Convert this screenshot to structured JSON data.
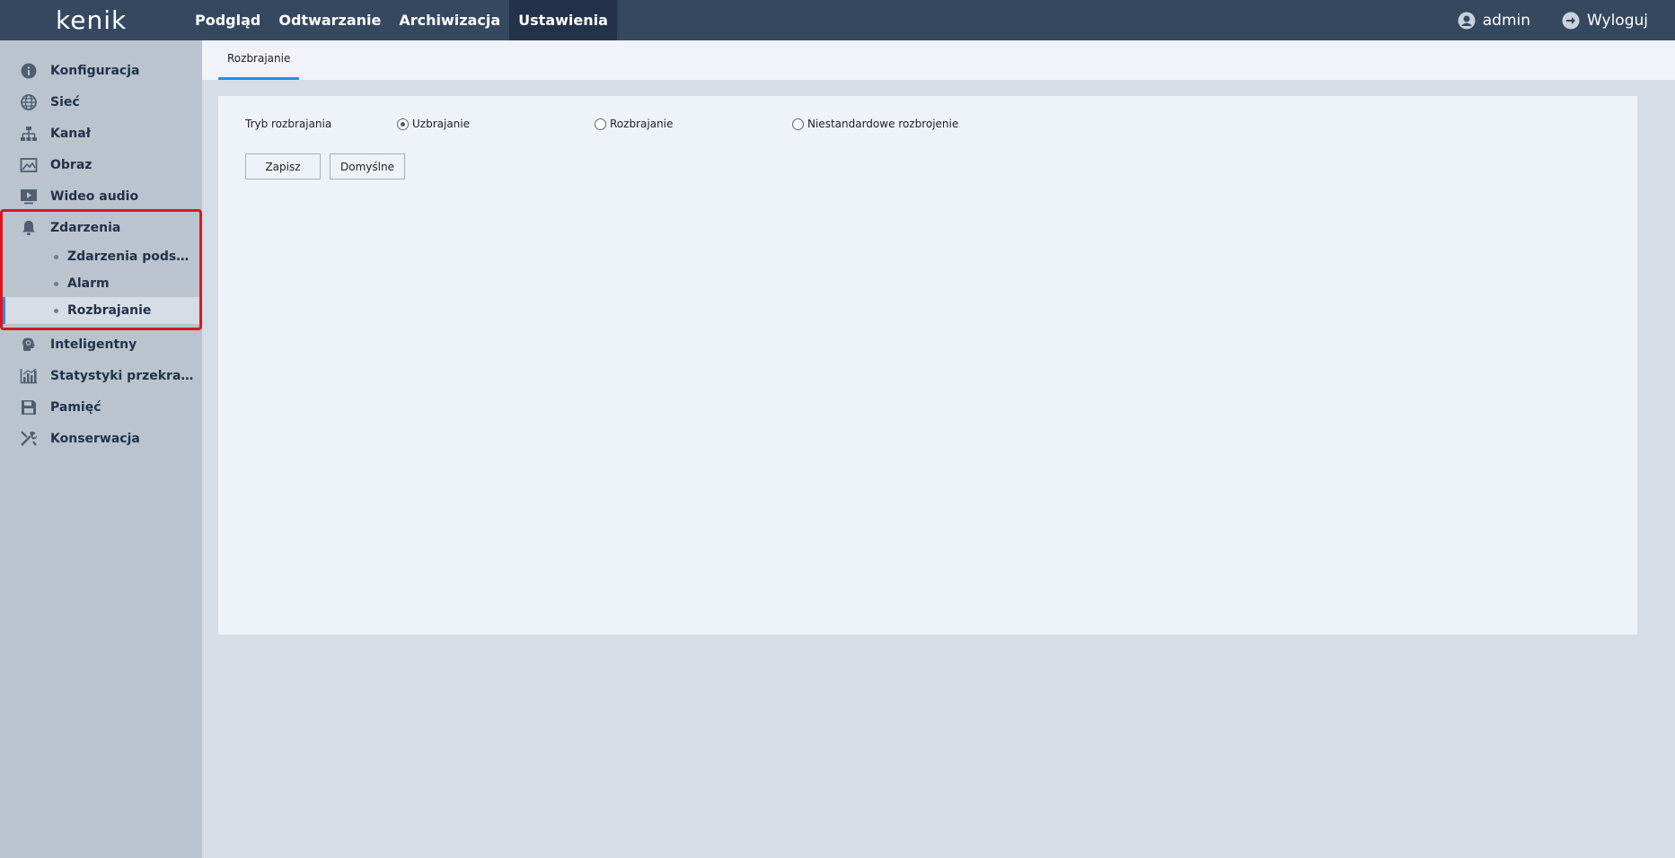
{
  "app": {
    "logo": "kenik"
  },
  "topnav": {
    "items": [
      {
        "label": "Podgląd"
      },
      {
        "label": "Odtwarzanie"
      },
      {
        "label": "Archiwizacja"
      },
      {
        "label": "Ustawienia"
      }
    ],
    "active_index": 3,
    "user": "admin",
    "logout": "Wyloguj"
  },
  "sidebar": {
    "items": [
      {
        "label": "Konfiguracja",
        "icon": "info-icon"
      },
      {
        "label": "Sieć",
        "icon": "globe-icon"
      },
      {
        "label": "Kanał",
        "icon": "network-icon"
      },
      {
        "label": "Obraz",
        "icon": "image-icon"
      },
      {
        "label": "Wideo audio",
        "icon": "video-icon"
      },
      {
        "label": "Zdarzenia",
        "icon": "bell-icon"
      },
      {
        "label": "Inteligentny",
        "icon": "brain-icon"
      },
      {
        "label": "Statystyki przekraczania",
        "icon": "chart-icon"
      },
      {
        "label": "Pamięć",
        "icon": "save-icon"
      },
      {
        "label": "Konserwacja",
        "icon": "tools-icon"
      }
    ],
    "subitems": [
      {
        "label": "Zdarzenia podstawowe"
      },
      {
        "label": "Alarm"
      },
      {
        "label": "Rozbrajanie"
      }
    ],
    "active_sub": "Rozbrajanie"
  },
  "main": {
    "tab": "Rozbrajanie",
    "mode_label": "Tryb rozbrajania",
    "options": [
      {
        "label": "Uzbrajanie",
        "selected": true
      },
      {
        "label": "Rozbrajanie",
        "selected": false
      },
      {
        "label": "Niestandardowe rozbrojenie",
        "selected": false
      }
    ],
    "save_label": "Zapisz",
    "default_label": "Domyślne"
  },
  "colors": {
    "topbar": "#354860",
    "sidebar": "#b9c4ce",
    "accent": "#2e8be6",
    "highlight": "#e0141c"
  }
}
